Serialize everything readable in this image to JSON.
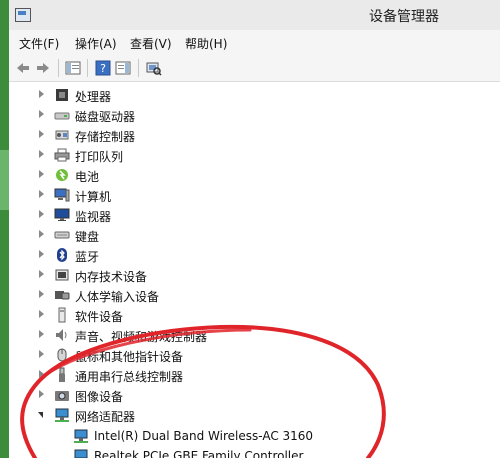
{
  "window": {
    "title": "设备管理器"
  },
  "menu": [
    "文件(F)",
    "操作(A)",
    "查看(V)",
    "帮助(H)"
  ],
  "toolbar": {
    "buttons": [
      {
        "name": "back-arrow-icon"
      },
      {
        "name": "forward-arrow-icon"
      },
      {
        "name": "show-hide-pane-icon"
      },
      {
        "name": "help-icon"
      },
      {
        "name": "properties-pane-icon"
      },
      {
        "name": "scan-hardware-icon"
      }
    ]
  },
  "tree": {
    "categories": [
      {
        "label": "处理器",
        "icon": "processor-icon"
      },
      {
        "label": "磁盘驱动器",
        "icon": "disk-drive-icon"
      },
      {
        "label": "存储控制器",
        "icon": "storage-controller-icon"
      },
      {
        "label": "打印队列",
        "icon": "printer-icon"
      },
      {
        "label": "电池",
        "icon": "battery-icon"
      },
      {
        "label": "计算机",
        "icon": "computer-icon"
      },
      {
        "label": "监视器",
        "icon": "monitor-icon"
      },
      {
        "label": "键盘",
        "icon": "keyboard-icon"
      },
      {
        "label": "蓝牙",
        "icon": "bluetooth-icon"
      },
      {
        "label": "内存技术设备",
        "icon": "memory-device-icon"
      },
      {
        "label": "人体学输入设备",
        "icon": "hid-icon"
      },
      {
        "label": "软件设备",
        "icon": "software-device-icon"
      },
      {
        "label": "声音、视频和游戏控制器",
        "icon": "sound-icon"
      },
      {
        "label": "鼠标和其他指针设备",
        "icon": "mouse-icon"
      },
      {
        "label": "通用串行总线控制器",
        "icon": "usb-icon"
      },
      {
        "label": "图像设备",
        "icon": "camera-icon"
      },
      {
        "label": "网络适配器",
        "icon": "network-adapter-icon",
        "expanded": true
      }
    ],
    "network_children": [
      {
        "label": "Intel(R) Dual Band Wireless-AC 3160",
        "icon": "network-card-icon"
      },
      {
        "label": "Realtek PCIe GBE Family Controller",
        "icon": "network-card-icon"
      }
    ]
  },
  "annotation": {
    "stroke_color": "#e0252a"
  }
}
